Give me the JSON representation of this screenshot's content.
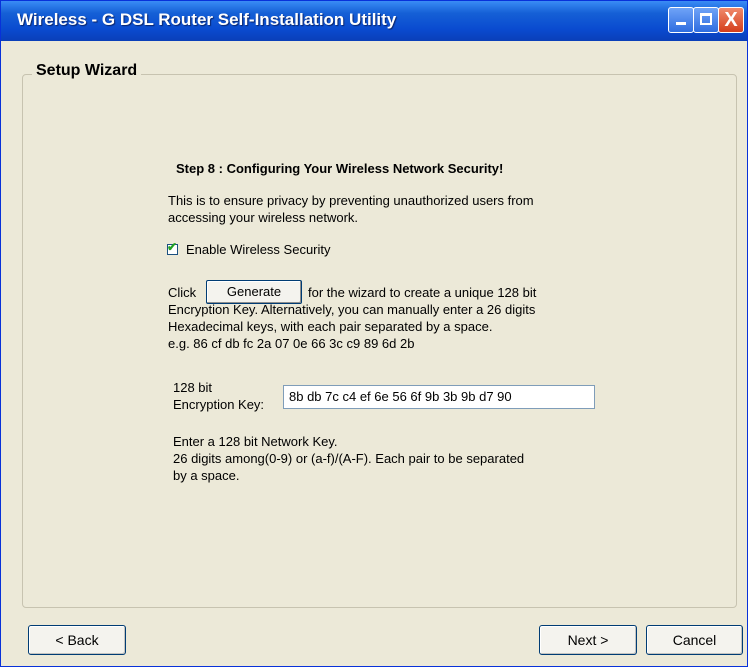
{
  "window": {
    "title": "Wireless - G DSL Router Self-Installation Utility",
    "close_glyph": "X"
  },
  "wizard": {
    "group_title": "Setup Wizard",
    "step_title": "Step 8 : Configuring Your Wireless Network Security!",
    "intro_line1": "This is to ensure privacy by preventing unauthorized users from",
    "intro_line2": "accessing your wireless network.",
    "enable_security": {
      "label": "Enable Wireless Security",
      "checked": true,
      "check_glyph": "✔"
    },
    "click_prefix": "Click",
    "generate_label": "Generate",
    "click_suffix": "for the wizard to create a unique 128 bit",
    "encryption_line1": "Encryption Key. Alternatively, you can manually enter a 26 digits",
    "encryption_line2": "Hexadecimal keys, with each pair separated by a space.",
    "example": "e.g. 86 cf db fc 2a 07 0e 66 3c c9 89 6d 2b",
    "key_label_line1": "128 bit",
    "key_label_line2": "Encryption Key:",
    "key_value": "8b db 7c c4 ef 6e 56 6f 9b 3b 9b d7 90",
    "hint_line1": "Enter a 128 bit Network Key.",
    "hint_line2": "26 digits among(0-9) or (a-f)/(A-F). Each pair to be separated",
    "hint_line3": "by a space."
  },
  "footer": {
    "back_label": "< Back",
    "next_label": "Next >",
    "cancel_label": "Cancel"
  }
}
